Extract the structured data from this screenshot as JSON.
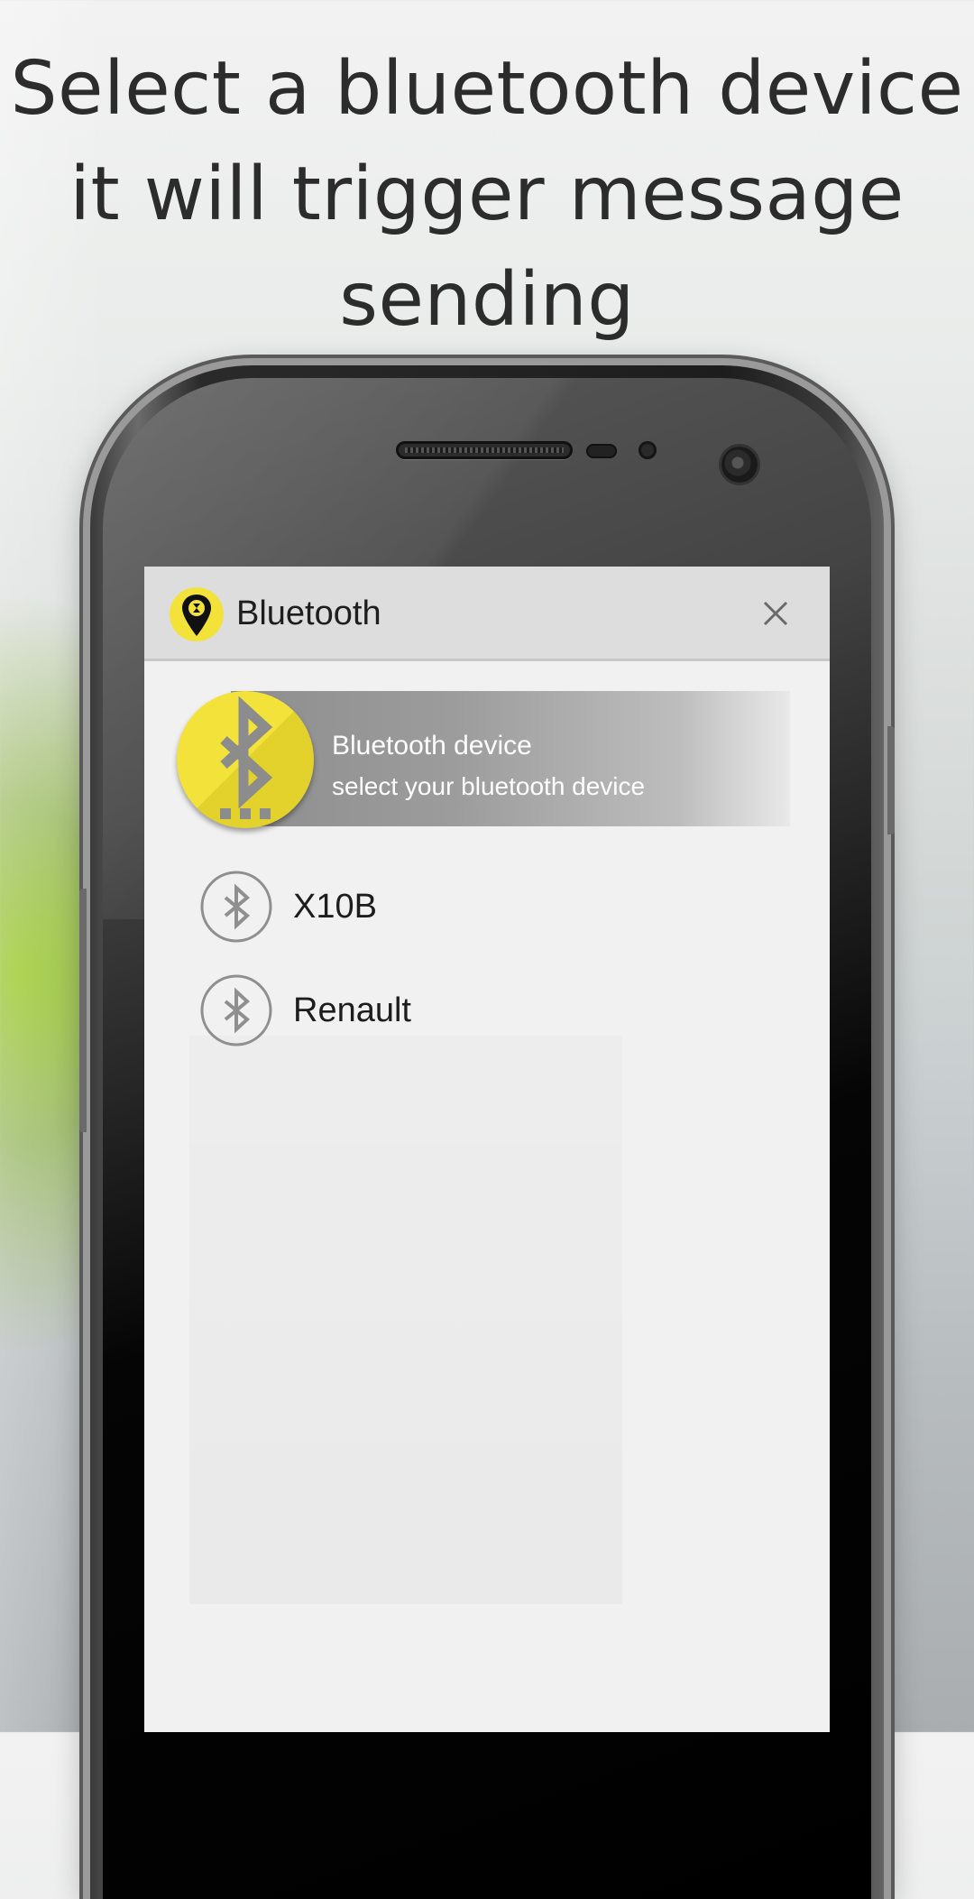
{
  "headline": {
    "line1": "Select a bluetooth device",
    "line2": "it will trigger message",
    "line3": "sending"
  },
  "dialog": {
    "title": "Bluetooth",
    "close_icon": "close-icon",
    "app_icon": "location-pin-logo-icon"
  },
  "header": {
    "title": "Bluetooth device",
    "subtitle": "select your bluetooth device",
    "icon": "bluetooth-icon",
    "accent_color": "#f3e23a"
  },
  "devices": [
    {
      "name": "X10B",
      "icon": "bluetooth-icon"
    },
    {
      "name": "Renault",
      "icon": "bluetooth-icon"
    }
  ]
}
